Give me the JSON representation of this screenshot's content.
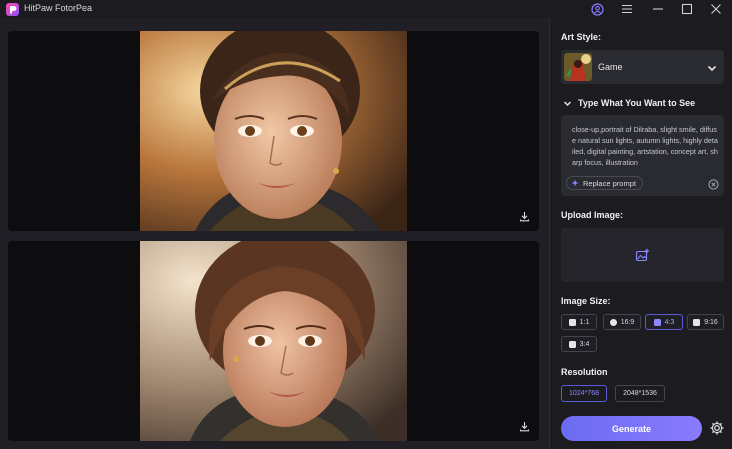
{
  "app": {
    "title": "HitPaw FotorPea"
  },
  "window_controls": [
    "account-icon",
    "menu-icon",
    "minimize-icon",
    "maximize-icon",
    "close-icon"
  ],
  "art_style": {
    "label": "Art Style:",
    "selected": "Game",
    "thumbnail_icon": "game-style-thumbnail"
  },
  "prompt": {
    "header": "Type What You Want to See",
    "text": "close-up,portrait of Dilraba, slight smile, diffuse natural sun lights, autumn lights, highly detailed, digital painting, artstation, concept art, sharp focus, illustration",
    "replace_label": "Replace prompt"
  },
  "upload": {
    "label": "Upload Image:",
    "icon": "add-image-icon"
  },
  "image_size": {
    "label": "Image Size:",
    "options": [
      {
        "label": "1:1",
        "icon": "instagram-icon",
        "selected": false
      },
      {
        "label": "16:9",
        "icon": "youtube-icon",
        "selected": false
      },
      {
        "label": "4:3",
        "icon": "twitter-icon",
        "selected": true
      },
      {
        "label": "9:16",
        "icon": "tiktok-icon",
        "selected": false
      },
      {
        "label": "3:4",
        "icon": "twitter-icon",
        "selected": false
      }
    ]
  },
  "resolution": {
    "label": "Resolution",
    "options": [
      {
        "label": "1024*768",
        "selected": true
      },
      {
        "label": "2048*1536",
        "selected": false
      }
    ]
  },
  "actions": {
    "generate": "Generate"
  },
  "colors": {
    "accent": "#6b6bf2",
    "panel": "#2a2a31",
    "background": "#1b1b20"
  }
}
